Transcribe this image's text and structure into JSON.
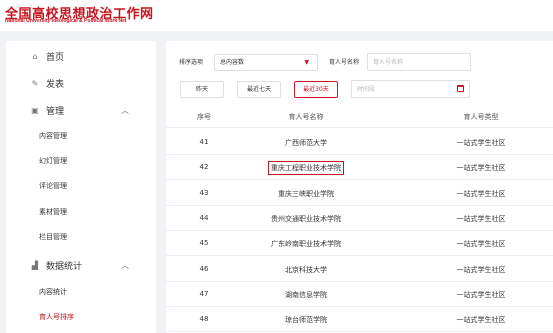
{
  "header": {
    "logo_cn": "全国高校思想政治工作网",
    "logo_en": "National University Ideological & Political Work Net"
  },
  "sidebar": {
    "home": "首页",
    "publish": "发表",
    "manage": "管理",
    "manage_items": [
      "内容管理",
      "幻灯管理",
      "评论管理",
      "素材管理",
      "栏目管理"
    ],
    "stats": "数据统计",
    "stats_items": [
      "内容统计",
      "育人号排序"
    ]
  },
  "filters": {
    "sort_label": "排序选项",
    "sort_value": "总内容数",
    "name_label": "育人号名称",
    "name_placeholder": "育人号名称",
    "quick": [
      "昨天",
      "最近七天",
      "最近30天"
    ],
    "time_placeholder": "时间段"
  },
  "table": {
    "headers": [
      "序号",
      "育人号名称",
      "育人号类型"
    ],
    "rows": [
      {
        "num": "41",
        "name": "广西师范大学",
        "type": "一站式学生社区"
      },
      {
        "num": "42",
        "name": "重庆工程职业技术学院",
        "type": "一站式学生社区"
      },
      {
        "num": "43",
        "name": "重庆三峡职业学院",
        "type": "一站式学生社区"
      },
      {
        "num": "44",
        "name": "贵州交通职业技术学院",
        "type": "一站式学生社区"
      },
      {
        "num": "45",
        "name": "广东岭南职业技术学院",
        "type": "一站式学生社区"
      },
      {
        "num": "46",
        "name": "北京科技大学",
        "type": "一站式学生社区"
      },
      {
        "num": "47",
        "name": "湖南信息学院",
        "type": "一站式学生社区"
      },
      {
        "num": "48",
        "name": "琼台师范学院",
        "type": "一站式学生社区"
      }
    ]
  },
  "colors": {
    "accent": "#c8141e"
  },
  "icons": [
    "home-icon",
    "edit-icon",
    "grid-icon",
    "bar-chart-icon",
    "chevron-up-icon",
    "calendar-icon",
    "caret-down-icon"
  ]
}
